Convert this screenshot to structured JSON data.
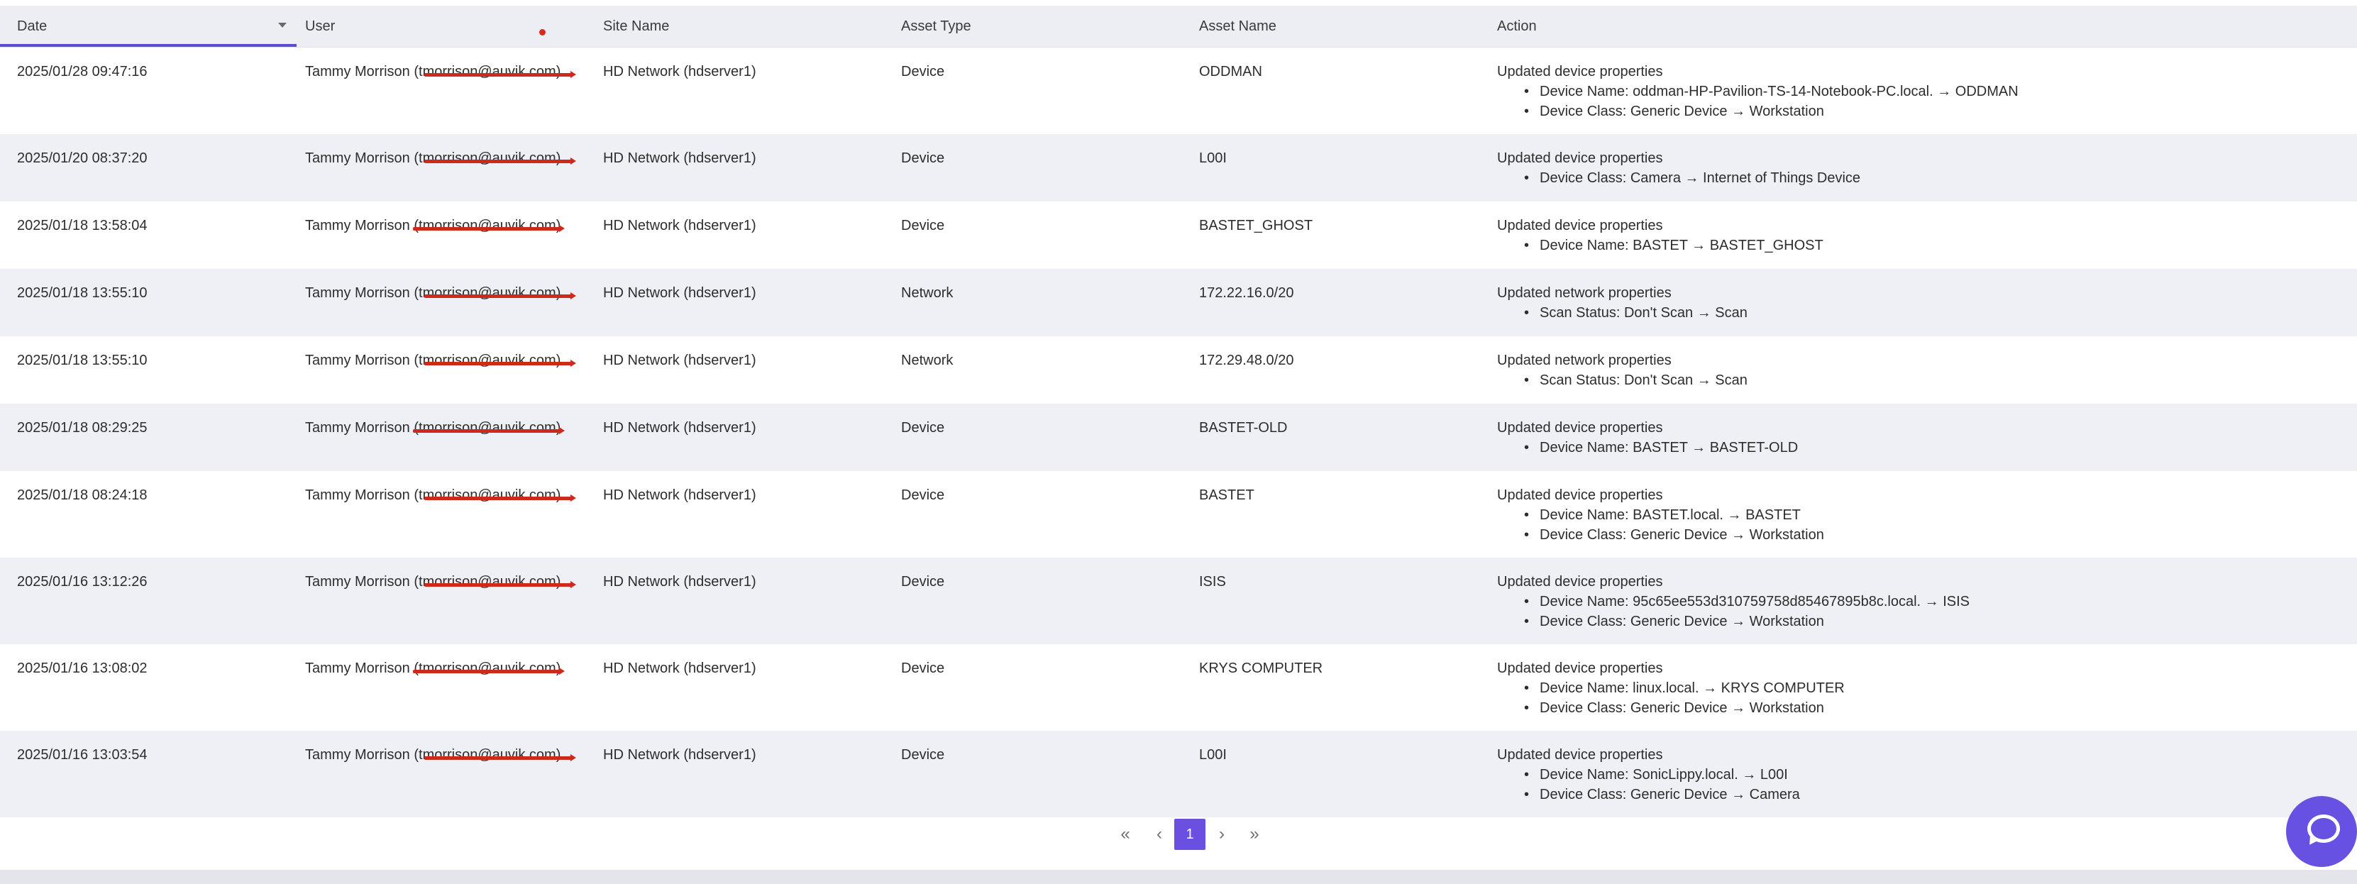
{
  "table": {
    "headers": {
      "date": "Date",
      "user": "User",
      "site": "Site Name",
      "type": "Asset Type",
      "asset": "Asset Name",
      "action": "Action"
    },
    "rows": [
      {
        "date": "2025/01/28 09:47:16",
        "user": "Tammy Morrison (tmorrison@auvik.com)",
        "site": "HD Network (hdserver1)",
        "type": "Device",
        "asset": "ODDMAN",
        "action": "Updated device properties",
        "details": [
          "Device Name: oddman-HP-Pavilion-TS-14-Notebook-PC.local. → ODDMAN",
          "Device Class: Generic Device → Workstation"
        ]
      },
      {
        "date": "2025/01/20 08:37:20",
        "user": "Tammy Morrison (tmorrison@auvik.com)",
        "site": "HD Network (hdserver1)",
        "type": "Device",
        "asset": "L00I",
        "action": "Updated device properties",
        "details": [
          "Device Class: Camera → Internet of Things Device"
        ]
      },
      {
        "date": "2025/01/18 13:58:04",
        "user": "Tammy Morrison (tmorrison@auvik.com)",
        "site": "HD Network (hdserver1)",
        "type": "Device",
        "asset": "BASTET_GHOST",
        "action": "Updated device properties",
        "details": [
          "Device Name: BASTET → BASTET_GHOST"
        ]
      },
      {
        "date": "2025/01/18 13:55:10",
        "user": "Tammy Morrison (tmorrison@auvik.com)",
        "site": "HD Network (hdserver1)",
        "type": "Network",
        "asset": "172.22.16.0/20",
        "action": "Updated network properties",
        "details": [
          "Scan Status: Don't Scan → Scan"
        ]
      },
      {
        "date": "2025/01/18 13:55:10",
        "user": "Tammy Morrison (tmorrison@auvik.com)",
        "site": "HD Network (hdserver1)",
        "type": "Network",
        "asset": "172.29.48.0/20",
        "action": "Updated network properties",
        "details": [
          "Scan Status: Don't Scan → Scan"
        ]
      },
      {
        "date": "2025/01/18 08:29:25",
        "user": "Tammy Morrison (tmorrison@auvik.com)",
        "site": "HD Network (hdserver1)",
        "type": "Device",
        "asset": "BASTET-OLD",
        "action": "Updated device properties",
        "details": [
          "Device Name: BASTET → BASTET-OLD"
        ]
      },
      {
        "date": "2025/01/18 08:24:18",
        "user": "Tammy Morrison (tmorrison@auvik.com)",
        "site": "HD Network (hdserver1)",
        "type": "Device",
        "asset": "BASTET",
        "action": "Updated device properties",
        "details": [
          "Device Name: BASTET.local. → BASTET",
          "Device Class: Generic Device → Workstation"
        ]
      },
      {
        "date": "2025/01/16 13:12:26",
        "user": "Tammy Morrison (tmorrison@auvik.com)",
        "site": "HD Network (hdserver1)",
        "type": "Device",
        "asset": "ISIS",
        "action": "Updated device properties",
        "details": [
          "Device Name: 95c65ee553d310759758d85467895b8c.local. → ISIS",
          "Device Class: Generic Device → Workstation"
        ]
      },
      {
        "date": "2025/01/16 13:08:02",
        "user": "Tammy Morrison (tmorrison@auvik.com)",
        "site": "HD Network (hdserver1)",
        "type": "Device",
        "asset": "KRYS COMPUTER",
        "action": "Updated device properties",
        "details": [
          "Device Name: linux.local. → KRYS COMPUTER",
          "Device Class: Generic Device → Workstation"
        ]
      },
      {
        "date": "2025/01/16 13:03:54",
        "user": "Tammy Morrison (tmorrison@auvik.com)",
        "site": "HD Network (hdserver1)",
        "type": "Device",
        "asset": "L00I",
        "action": "Updated device properties",
        "details": [
          "Device Name: SonicLippy.local. → L00I",
          "Device Class: Generic Device → Camera"
        ]
      }
    ]
  },
  "pagination": {
    "first_icon": "double-chevron-left-icon",
    "prev_icon": "chevron-left-icon",
    "current_page": "1",
    "next_icon": "chevron-right-icon",
    "last_icon": "double-chevron-right-icon",
    "first_glyph": "«",
    "prev_glyph": "‹",
    "next_glyph": "›",
    "last_glyph": "»"
  },
  "chat": {
    "icon": "chat-bubble-icon"
  },
  "colors": {
    "accent": "#6a4fe0",
    "header_bg": "#eceef4",
    "alt_row_bg": "#eef0f5",
    "redaction": "#cc2a1a"
  }
}
